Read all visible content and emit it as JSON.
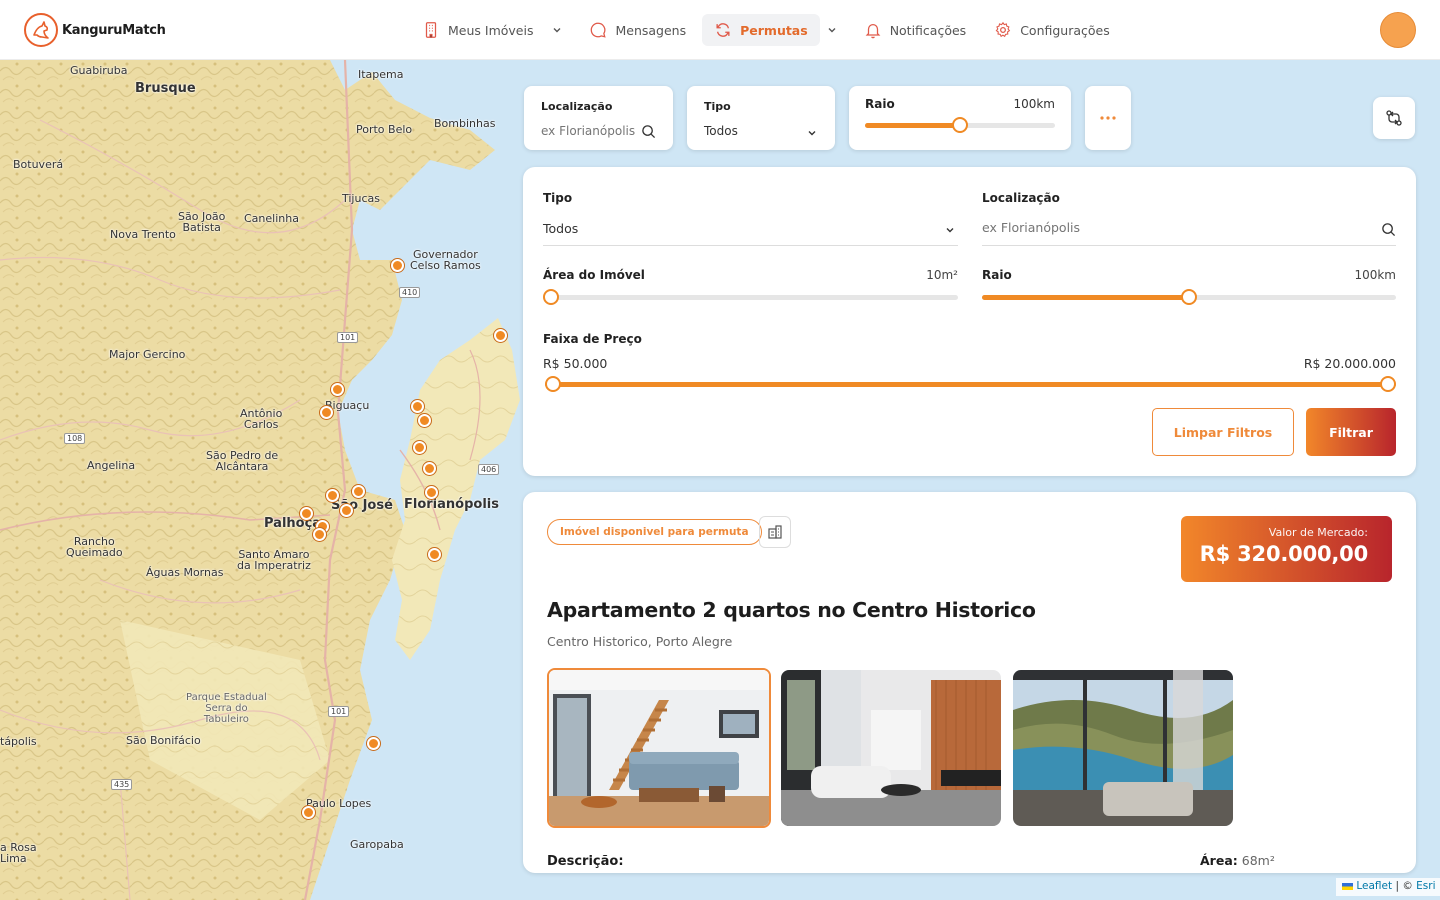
{
  "app": {
    "name": "KanguruMatch"
  },
  "nav": {
    "items": [
      {
        "label": "Meus Imóveis",
        "icon": "building-icon",
        "dropdown": true,
        "active": false
      },
      {
        "label": "Mensagens",
        "icon": "chat-icon",
        "dropdown": false,
        "active": false
      },
      {
        "label": "Permutas",
        "icon": "refresh-icon",
        "dropdown": true,
        "active": true
      },
      {
        "label": "Notificações",
        "icon": "bell-icon",
        "dropdown": false,
        "active": false
      },
      {
        "label": "Configurações",
        "icon": "gear-icon",
        "dropdown": false,
        "active": false
      }
    ],
    "accent": "#e36b2c"
  },
  "topbar": {
    "location_label": "Localização",
    "location_placeholder": "ex Florianópolis",
    "type_label": "Tipo",
    "type_value": "Todos",
    "radius_label": "Raio",
    "radius_value": "100km",
    "radius_fraction": 0.5
  },
  "filters": {
    "type_label": "Tipo",
    "type_value": "Todos",
    "location_label": "Localização",
    "location_placeholder": "ex Florianópolis",
    "area_label": "Área do Imóvel",
    "area_value": "10m²",
    "area_fraction": 0.0,
    "radius_label": "Raio",
    "radius_value": "100km",
    "radius_fraction": 0.5,
    "price_label": "Faixa de Preço",
    "price_min": "R$ 50.000",
    "price_max": "R$ 20.000.000",
    "price_range": [
      0.0,
      1.0
    ],
    "clear_label": "Limpar Filtros",
    "apply_label": "Filtrar"
  },
  "listing": {
    "badge": "Imóvel disponivel para permuta",
    "price_label": "Valor de Mercado:",
    "price_value": "R$ 320.000,00",
    "title": "Apartamento 2 quartos no Centro Historico",
    "location": "Centro Historico, Porto Alegre",
    "description_label": "Descrição:",
    "area_label": "Área:",
    "area_value": "68m²",
    "photos": [
      "living-room-stairs",
      "living-room-wood-wall",
      "living-room-sea-view"
    ]
  },
  "map": {
    "labels": [
      "Guabiruba",
      "Brusque",
      "Itapema",
      "Porto Belo",
      "Bombinhas",
      "Botuverá",
      "São João\nBatista",
      "Canelinha",
      "Nova Trento",
      "Tijucas",
      "Governador\nCelso Ramos",
      "Major Gercino",
      "Biguaçu",
      "Antônio\nCarlos",
      "São Pedro de\nAlcântara",
      "Angelina",
      "São José",
      "Florianópolis",
      "Palhoça",
      "Rancho\nQueimado",
      "Santo Amaro\nda Imperatriz",
      "Águas Mornas",
      "Parque Estadual\nSerra do\nTabuleiro",
      "São Bonifácio",
      "tápolis",
      "Paulo Lopes",
      "Garopaba",
      "a Rosa\nLima"
    ],
    "roads": [
      "410",
      "101",
      "108",
      "406",
      "101",
      "435"
    ],
    "attribution_leaflet": "Leaflet",
    "attribution_sep": " | © ",
    "attribution_esri": "Esri"
  }
}
